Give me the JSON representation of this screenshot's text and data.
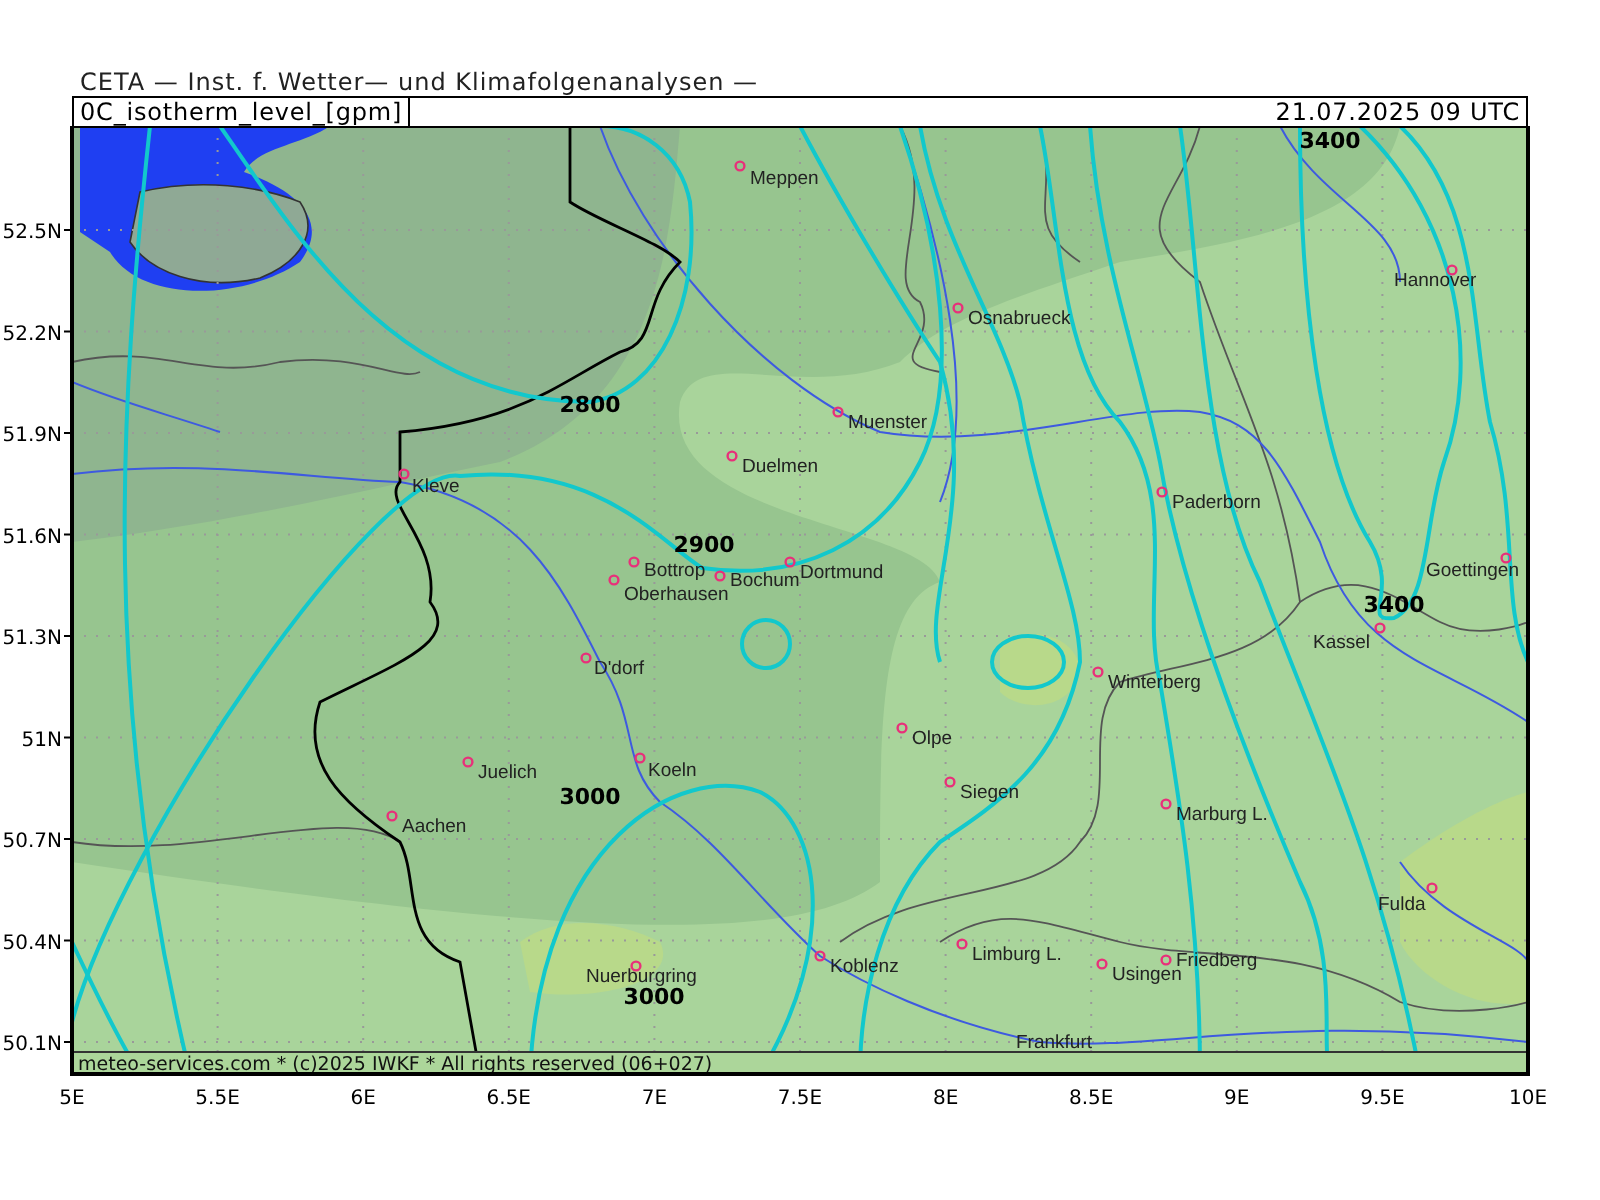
{
  "header": "CETA — Inst. f. Wetter— und Klimafolgenanalysen —",
  "panel": {
    "title": "0C_isotherm_level_[gpm]",
    "valid_time": "21.07.2025 09 UTC"
  },
  "map": {
    "cities": [
      {
        "name": "Meppen"
      },
      {
        "name": "Hannover"
      },
      {
        "name": "Osnabrueck"
      },
      {
        "name": "Muenster"
      },
      {
        "name": "Duelmen"
      },
      {
        "name": "Kleve"
      },
      {
        "name": "Paderborn"
      },
      {
        "name": "Bottrop"
      },
      {
        "name": "Dortmund"
      },
      {
        "name": "Goettingen"
      },
      {
        "name": "Oberhausen"
      },
      {
        "name": "Bochum"
      },
      {
        "name": "Kassel"
      },
      {
        "name": "D'dorf"
      },
      {
        "name": "Winterberg"
      },
      {
        "name": "Olpe"
      },
      {
        "name": "Koeln"
      },
      {
        "name": "Juelich"
      },
      {
        "name": "Siegen"
      },
      {
        "name": "Aachen"
      },
      {
        "name": "Marburg L."
      },
      {
        "name": "Fulda"
      },
      {
        "name": "Nuerburgring"
      },
      {
        "name": "Koblenz"
      },
      {
        "name": "Limburg L."
      },
      {
        "name": "Usingen"
      },
      {
        "name": "Friedberg"
      },
      {
        "name": "Frankfurt"
      }
    ],
    "contour_labels": [
      "3400",
      "2800",
      "2900",
      "3400",
      "3000",
      "3000"
    ],
    "footer": "meteo-services.com * (c)2025 IWKF * All rights reserved (06+027)",
    "lat_ticks": [
      "52.5N",
      "52.2N",
      "51.9N",
      "51.6N",
      "51.3N",
      "51N",
      "50.7N",
      "50.4N",
      "50.1N"
    ],
    "lon_ticks": [
      "5E",
      "5.5E",
      "6E",
      "6.5E",
      "7E",
      "7.5E",
      "8E",
      "8.5E",
      "9E",
      "9.5E",
      "10E"
    ]
  }
}
